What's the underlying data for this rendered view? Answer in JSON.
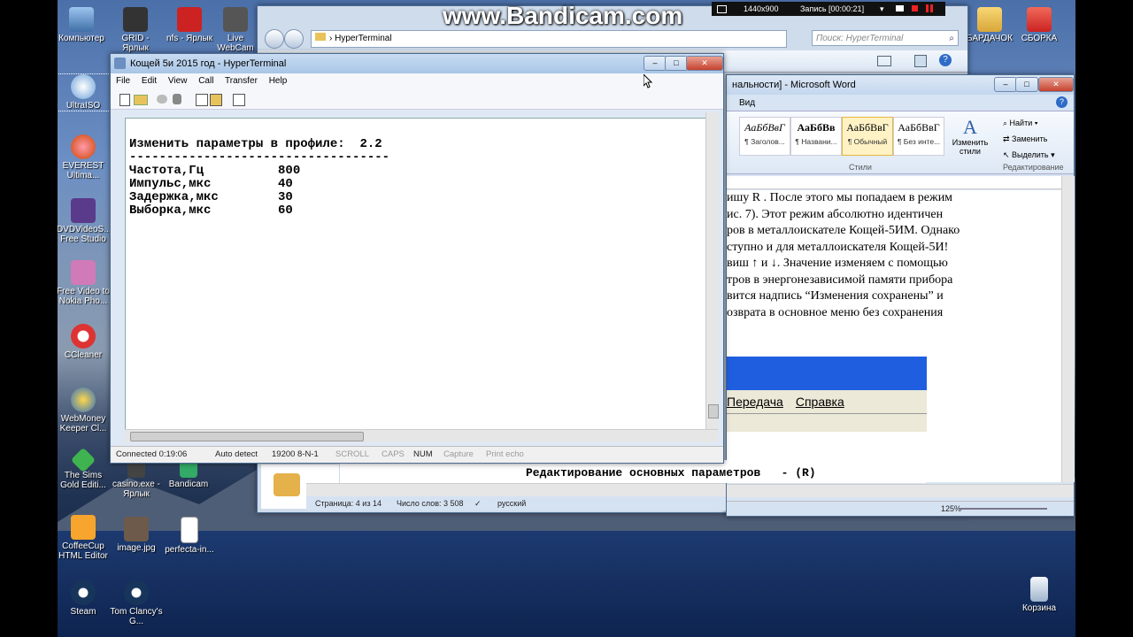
{
  "watermark": {
    "brand": "www.Bandicam.com",
    "resolution": "1440x900",
    "recording": "Запись [00:00:21]"
  },
  "desktop_icons": [
    {
      "label": "Компьютер",
      "icon": "computer-icon"
    },
    {
      "label": "GRID - Ярлык",
      "icon": "game-icon"
    },
    {
      "label": "nfs - Ярлык",
      "icon": "game-icon"
    },
    {
      "label": "Live WebCam",
      "icon": "webcam-icon"
    },
    {
      "label": "UltraISO",
      "icon": "disc-icon"
    },
    {
      "label": "EVEREST Ultima...",
      "icon": "everest-icon"
    },
    {
      "label": "DVDVideoS... Free Studio",
      "icon": "video-icon"
    },
    {
      "label": "Free Video to Nokia Pho...",
      "icon": "video-icon"
    },
    {
      "label": "CCleaner",
      "icon": "ccleaner-icon"
    },
    {
      "label": "WebMoney Keeper Cl...",
      "icon": "webmoney-icon"
    },
    {
      "label": "The Sims Gold Editi...",
      "icon": "sims-icon"
    },
    {
      "label": "casino.exe - Ярлык",
      "icon": "casino-icon"
    },
    {
      "label": "Bandicam",
      "icon": "bandicam-icon"
    },
    {
      "label": "CoffeeCup HTML Editor",
      "icon": "coffeecup-icon"
    },
    {
      "label": "image.jpg",
      "icon": "image-icon"
    },
    {
      "label": "perfecta-in...",
      "icon": "file-icon"
    },
    {
      "label": "Steam",
      "icon": "steam-icon"
    },
    {
      "label": "Tom Clancy's G...",
      "icon": "game-icon"
    },
    {
      "label": "БАРДАЧОК",
      "icon": "folder-icon"
    },
    {
      "label": "СБОРКА",
      "icon": "folder-icon"
    },
    {
      "label": "Корзина",
      "icon": "recycle-bin-icon"
    }
  ],
  "explorer": {
    "path": "HyperTerminal",
    "search_placeholder": "Поиск: HyperTerminal"
  },
  "word": {
    "title": "нальности] - Microsoft Word",
    "tab_view": "Вид",
    "styles": [
      {
        "sample": "АаБбВвГ",
        "label": "¶ Заголов..."
      },
      {
        "sample": "АаБбВв",
        "label": "¶ Названи..."
      },
      {
        "sample": "АаБбВвГ",
        "label": "¶ Обычный"
      },
      {
        "sample": "АаБбВвГ",
        "label": "¶ Без инте..."
      }
    ],
    "change_styles": "Изменить стили",
    "find": "Найти",
    "replace": "Заменить",
    "select": "Выделить",
    "group_styles": "Стили",
    "group_edit": "Редактирование",
    "doc_lines": [
      "ишу R . После этого мы попадаем в режим",
      "ис. 7). Этот режим абсолютно идентичен",
      "ров в металлоискателе Кощей-5ИМ. Однако",
      "ступно и для металлоискателя Кощей-5И!",
      "виш ↑ и ↓. Значение изменяем с помощью",
      "тров в энергонезависимой памяти прибора",
      "вится надпись “Изменения сохранены” и",
      "озврата в основное меню без сохранения"
    ],
    "embedded_menu": [
      "Передача",
      "Справка"
    ],
    "embedded_text": "Редактирование основных параметров   - (R)",
    "status_page": "Страница: 4 из 14",
    "status_words": "Число слов: 3 508",
    "status_lang": "русский",
    "zoom": "125%"
  },
  "hyperterminal": {
    "title": "Кощей 5и 2015 год - HyperTerminal",
    "menu": [
      "File",
      "Edit",
      "View",
      "Call",
      "Transfer",
      "Help"
    ],
    "terminal_lines": [
      "Изменить параметры в профиле:  2.2",
      "-----------------------------------",
      "Частота,Гц          800",
      "Импульс,мкс         40",
      "Задержка,мкс        30",
      "Выборка,мкс         60"
    ],
    "status": {
      "connected": "Connected 0:19:06",
      "detect": "Auto detect",
      "settings": "19200 8-N-1",
      "scroll": "SCROLL",
      "caps": "CAPS",
      "num": "NUM",
      "capture": "Capture",
      "print": "Print echo"
    }
  }
}
